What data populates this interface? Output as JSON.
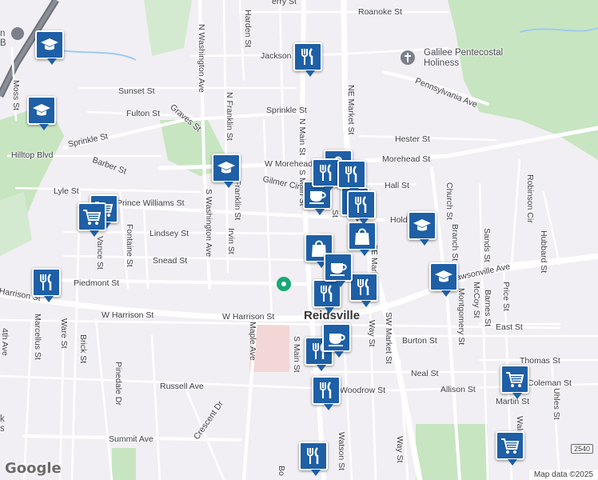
{
  "city_label": "Reidsville",
  "attribution": "Map data ©2025",
  "google_logo": "Google",
  "route_shield": "2540",
  "poi": {
    "church": "Galilee Pentecostal Holiness",
    "partial_top_left": "n",
    "partial_top_left2": "B",
    "partial_bottom_left": "k",
    "partial_bottom_left2": "s"
  },
  "streets": {
    "roanoke": "Roanoke St",
    "jackson": "Jackson St",
    "pennsylvania": "Pennsylvania Ave",
    "sunset": "Sunset St",
    "fulton": "Fulton St",
    "graves": "Graves St",
    "sprinkle_w": "Sprinkle St",
    "sprinkle_e": "Sprinkle St",
    "hester": "Hester St",
    "hilltop": "Hilltop Blvd",
    "barber": "Barber St",
    "w_morehead": "W Morehead St",
    "morehead_e": "Morehead St",
    "lyle": "Lyle St",
    "prince_williams": "Prince Williams St",
    "gilmer": "Gilmer Cir",
    "hall": "Hall St",
    "holden": "Hold",
    "lindsey": "Lindsey St",
    "snead": "Snead St",
    "piedmont": "Piedmont St",
    "harrison_w": "Harrison St",
    "w_harrison": "W Harrison St",
    "w_harrison2": "W Harrison St",
    "burton": "Burton St",
    "neal": "Neal St",
    "russell": "Russell Ave",
    "woodrow": "Woodrow St",
    "allison": "Allison St",
    "summit": "Summit Ave",
    "east": "East St",
    "thomas": "Thomas St",
    "coleman": "Coleman St",
    "martin": "Martin St",
    "dawsonville": "Dawsonville Ave",
    "n_washington": "N Washington Ave",
    "s_washington": "S Washington Ave",
    "n_franklin": "N Franklin St",
    "franklin": "Franklin St",
    "irvin": "Irvin St",
    "harden": "Harden St",
    "n_main": "N Main St",
    "s_main_top": "S Main St",
    "s_main": "S Main St",
    "ne_market": "NE Market St",
    "se_market": "SE Market St",
    "sw_market": "SW Market St",
    "market_short": "St",
    "way1": "Way St",
    "way2": "Way St",
    "watson": "Watson St",
    "moss": "Moss St",
    "vance": "Vance St",
    "fontaine": "Fontaine St",
    "ware": "Ware St",
    "brick": "Brick St",
    "marcellus": "Marcellus St",
    "maple": "Maple Ave",
    "pinedale": "Pinedale Dr",
    "crescent": "Crescent Dr",
    "church": "Church St",
    "branch": "Branch St",
    "montgomery": "Montgomery St",
    "mccoy": "McCoy St",
    "barnes": "Barnes St",
    "price": "Price St",
    "robinson": "Robinson Cir",
    "hubbard": "Hubbard St",
    "sands": "Sands St",
    "walnut": "Walnut St",
    "uhles": "Uhles St",
    "fourth": "4th Ave",
    "perry_partial": "erry St",
    "bottom_b": "Bo"
  },
  "markers": [
    {
      "icon": "school"
    },
    {
      "icon": "school"
    },
    {
      "icon": "restaurant"
    },
    {
      "icon": "school"
    },
    {
      "icon": "grocery"
    },
    {
      "icon": "grocery"
    },
    {
      "icon": "restaurant"
    },
    {
      "icon": "coffee"
    },
    {
      "icon": "shopping"
    },
    {
      "icon": "restaurant"
    },
    {
      "icon": "restaurant"
    },
    {
      "icon": "restaurant"
    },
    {
      "icon": "shopping"
    },
    {
      "icon": "shopping"
    },
    {
      "icon": "coffee"
    },
    {
      "icon": "restaurant"
    },
    {
      "icon": "restaurant"
    },
    {
      "icon": "school"
    },
    {
      "icon": "school"
    },
    {
      "icon": "coffee"
    },
    {
      "icon": "restaurant"
    },
    {
      "icon": "restaurant"
    },
    {
      "icon": "restaurant"
    },
    {
      "icon": "grocery"
    },
    {
      "icon": "grocery"
    },
    {
      "icon": "restaurant"
    }
  ],
  "colors": {
    "marker": "#1e5fa5",
    "park": "#c7e5c0",
    "road": "#ffffff",
    "highway": "#6b7078",
    "water": "#9ecbf0",
    "land": "#f1eff3"
  }
}
